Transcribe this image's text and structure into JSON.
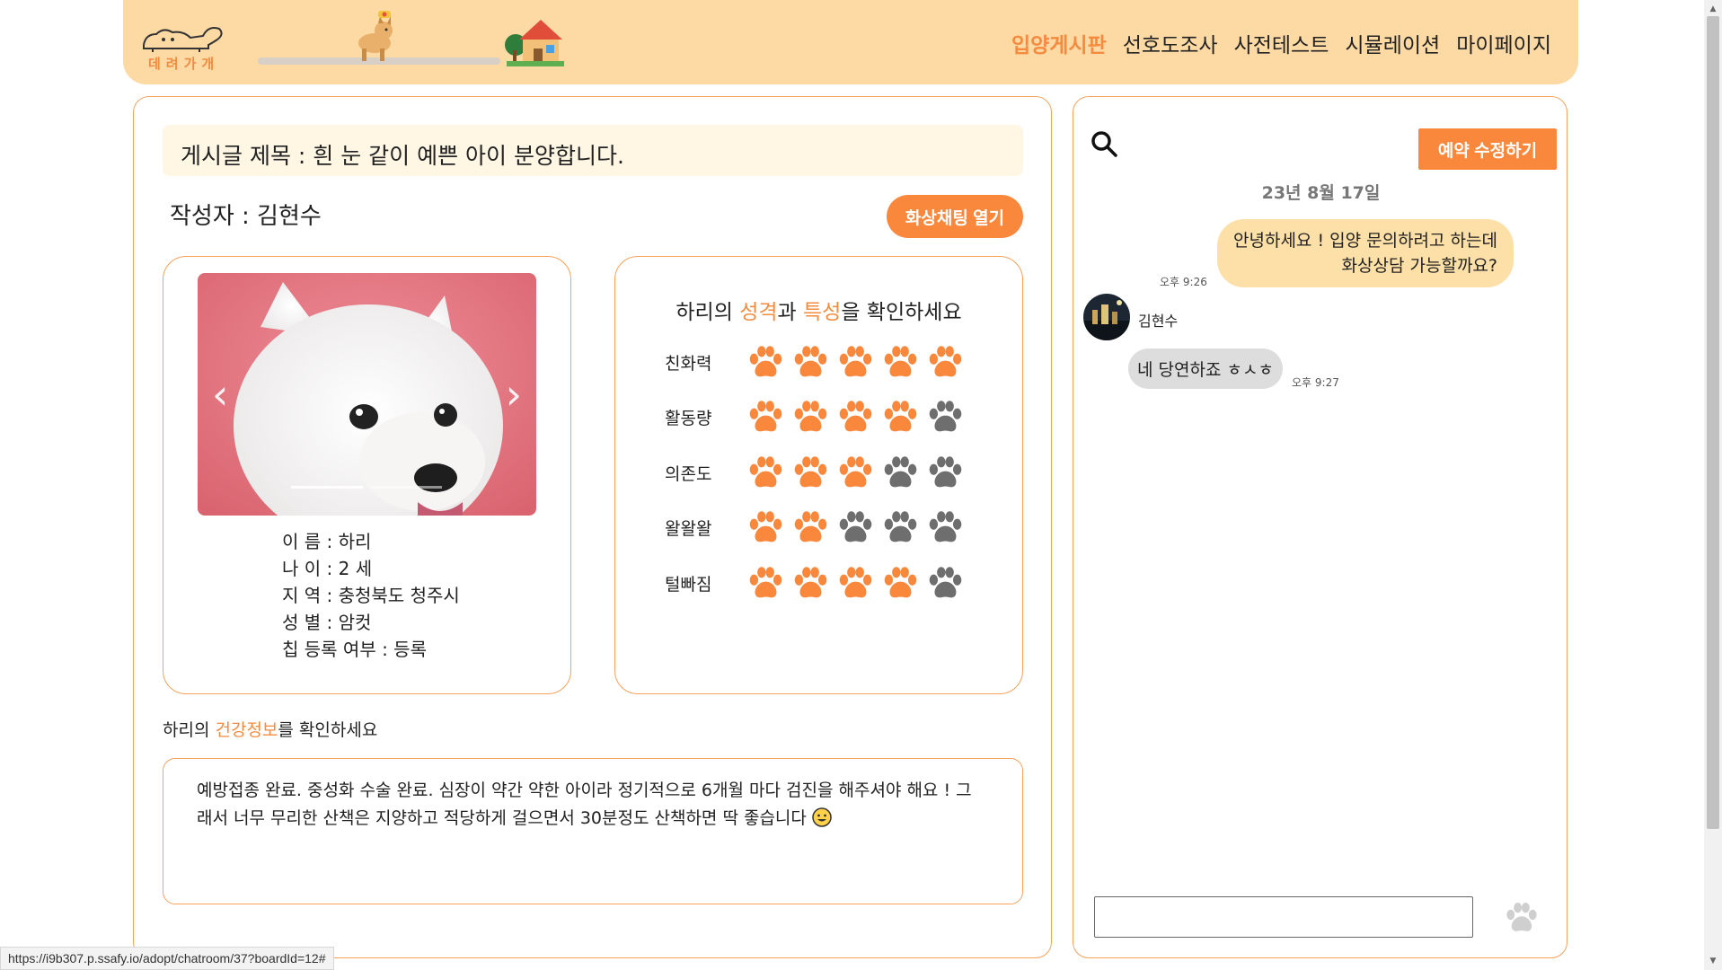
{
  "header": {
    "logo_text": "데려가개",
    "nav": [
      {
        "label": "입양게시판",
        "active": true
      },
      {
        "label": "선호도조사",
        "active": false
      },
      {
        "label": "사전테스트",
        "active": false
      },
      {
        "label": "시뮬레이션",
        "active": false
      },
      {
        "label": "마이페이지",
        "active": false
      }
    ]
  },
  "post": {
    "title": "게시글 제목 : 흰 눈 같이 예쁜 아이 분양합니다.",
    "author": "작성자 : 김현수",
    "video_chat_label": "화상채팅 열기",
    "carousel": {
      "prev_glyph": "‹",
      "next_glyph": "›",
      "indicator_count": 2,
      "active_indicator": 0
    },
    "info": [
      "이 름 : 하리",
      "나 이 : 2 세",
      "지 역 : 충청북도 청주시",
      "성 별 : 암컷",
      "칩 등록 여부 : 등록"
    ],
    "traits_heading": {
      "prefix": "하리의 ",
      "word1": "성격",
      "middle": "과 ",
      "word2": "특성",
      "suffix": "을 확인하세요"
    },
    "traits": [
      {
        "label": "친화력",
        "score": 5
      },
      {
        "label": "활동량",
        "score": 4
      },
      {
        "label": "의존도",
        "score": 3
      },
      {
        "label": "왈왈왈",
        "score": 2
      },
      {
        "label": "털빠짐",
        "score": 4
      }
    ],
    "trait_max": 5,
    "health_heading": {
      "prefix": "하리의 ",
      "accent": "건강정보",
      "suffix": "를 확인하세요"
    },
    "health_text": "예방접종 완료. 중성화 수술 완료. 심장이 약간 약한 아이라 정기적으로 6개월 마다 검진을 해주셔야 해요 ! 그래서 너무 무리한 산책은 지양하고 적당하게 걸으면서 30분정도 산책하면 딱 좋습니다"
  },
  "chat": {
    "edit_button": "예약 수정하기",
    "date": "23년 8월 17일",
    "messages": [
      {
        "from": "me",
        "text_line1": "안녕하세요 ! 입양 문의하려고 하는데",
        "text_line2": "화상상담 가능할까요?",
        "time": "오후 9:26"
      },
      {
        "from": "other",
        "sender": "김현수",
        "text": "네 당연하죠 ㅎㅅㅎ",
        "time": "오후 9:27"
      }
    ],
    "input_value": ""
  },
  "status_bar": {
    "url": "https://i9b307.p.ssafy.io/adopt/chatroom/37?boardId=12#"
  },
  "colors": {
    "accent": "#f9883d",
    "header_bg": "#fdd9a4",
    "paw_active": "#f9883d",
    "paw_inactive": "#6e6e6e"
  }
}
